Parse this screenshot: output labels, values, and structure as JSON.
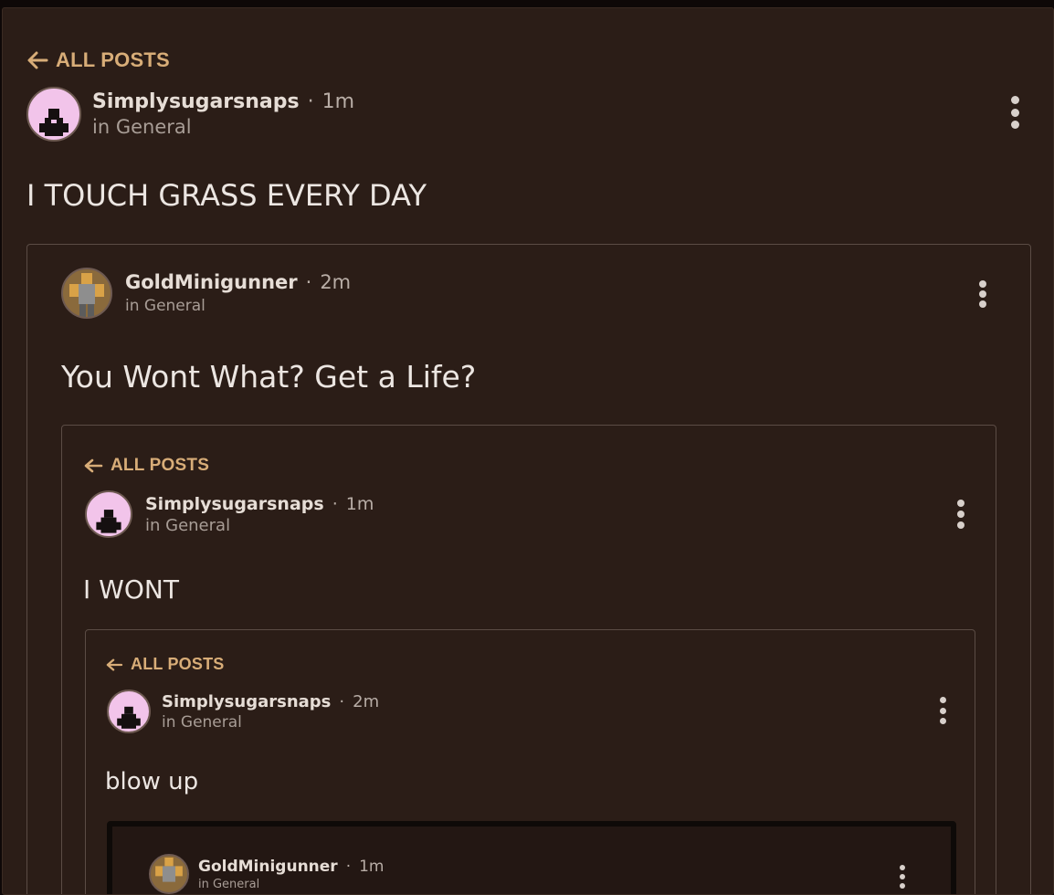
{
  "level1": {
    "back_label": "ALL POSTS",
    "username": "Simplysugarsnaps",
    "time": "1m",
    "category": "in General",
    "text": "I TOUCH GRASS EVERY DAY"
  },
  "level2": {
    "username": "GoldMinigunner",
    "time": "2m",
    "category": "in General",
    "text": "You Wont What? Get a Life?"
  },
  "level3": {
    "back_label": "ALL POSTS",
    "username": "Simplysugarsnaps",
    "time": "1m",
    "category": "in General",
    "text": "I WONT"
  },
  "level4": {
    "back_label": "ALL POSTS",
    "username": "Simplysugarsnaps",
    "time": "2m",
    "category": "in General",
    "text": "blow up"
  },
  "level5": {
    "username": "GoldMinigunner",
    "time": "1m",
    "category": "in General"
  },
  "separator": "·",
  "colors": {
    "background": "#2b1d17",
    "accent": "#d8ad78",
    "text": "#ece6e2",
    "avatar_pink": "#f2c4ea"
  },
  "icons": {
    "back": "arrow-left-icon",
    "menu": "more-vertical-icon"
  }
}
